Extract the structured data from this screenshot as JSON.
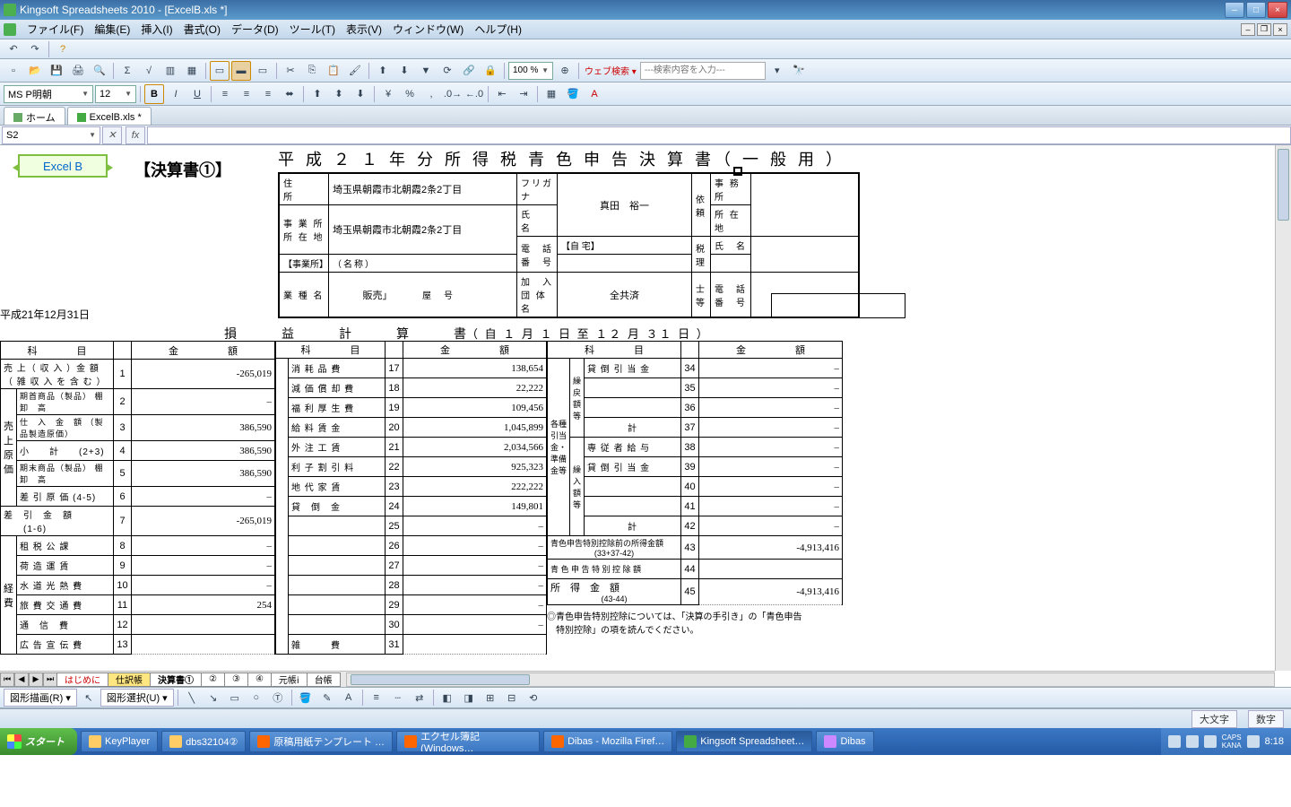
{
  "app": {
    "title": "Kingsoft Spreadsheets 2010 - [ExcelB.xls *]"
  },
  "menu": [
    "ファイル(F)",
    "編集(E)",
    "挿入(I)",
    "書式(O)",
    "データ(D)",
    "ツール(T)",
    "表示(V)",
    "ウィンドウ(W)",
    "ヘルプ(H)"
  ],
  "font": {
    "name": "MS P明朝",
    "size": "12"
  },
  "zoom": "100 %",
  "websearch": {
    "label": "ウェブ検索 ▾",
    "placeholder": "---検索内容を入力---"
  },
  "doctabs": {
    "home": "ホーム",
    "file": "ExcelB.xls *"
  },
  "namebox": "S2",
  "drawbar": {
    "shape_menu": "図形描画(R) ▾",
    "select_menu": "図形選択(U) ▾"
  },
  "status": {
    "caps": "大文字",
    "num": "数字"
  },
  "sheettabs": [
    "はじめに",
    "仕訳帳",
    "決算書①",
    "②",
    "③",
    "④",
    "元帳ⅰ",
    "台帳"
  ],
  "taskbar": {
    "start": "スタート",
    "items": [
      "KeyPlayer",
      "dbs32104②",
      "原稿用紙テンプレート …",
      "エクセル簿記(Windows…",
      "Dibas - Mozilla Firef…",
      "Kingsoft Spreadsheet…",
      "Dibas"
    ],
    "caps": "CAPS",
    "kana": "KANA",
    "clock": "8:18"
  },
  "doc": {
    "button_label": "Excel B",
    "heading_bracket": "【決算書①】",
    "heading_main": "平 成 ２ １ 年 分 所 得 税 青 色 申 告 決 算 書（ 一 般 用 ）",
    "info": {
      "address_lbl": "住　　所",
      "address": "埼玉県朝霞市北朝霞2条2丁目",
      "office_lbl1": "事 業 所",
      "office_lbl2": "所 在 地",
      "office": "埼玉県朝霞市北朝霞2条2丁目",
      "biz_lbl": "業 種 名",
      "biz": "販売」",
      "code_lbl": "屋　号",
      "furi_lbl": "フリガナ",
      "name_lbl": "氏　　名",
      "name": "真田　裕一",
      "tel_lbl1": "電　話",
      "tel_lbl2": "番　号",
      "tel_home": "【自 宅】",
      "tel_office": "【事業所】",
      "org_lbl1": "加　入",
      "org_lbl2": "団 体 名",
      "org": "全共済",
      "req_lbl": "依頼",
      "acct_lbl1": "事 務 所",
      "acct_lbl2": "所 在 地",
      "tax_lbl": "税理",
      "taxname_lbl1": "氏　名",
      "taxname_lbl2": "（名称）",
      "lawyer_lbl": "士等",
      "lawyertel_lbl1": "電　話",
      "lawyertel_lbl2": "番　号"
    },
    "date": "平成21年12月31日",
    "pl_title": "損　益　計　算　書",
    "pl_range": "（ 自 １ 月 １ 日 至 １２ 月 ３１ 日 ）",
    "hdr": {
      "subject": "科　　　　目",
      "amount": "金　　　　　額"
    },
    "col1": {
      "r1_name": "売 上（ 収 入 ）金 額",
      "r1_sub": "（ 雑 収 入 を 含 む ）",
      "r1_no": "1",
      "r1_amt": "-265,019",
      "grp1": "売上原価",
      "r2_name": "期首商品（製品）\n棚　卸　高",
      "r2_no": "2",
      "r2_amt": "–",
      "r3_name": "仕　入　金　額\n（製品製造原価）",
      "r3_no": "3",
      "r3_amt": "386,590",
      "r4_name": "小　　計　　(2+3)",
      "r4_no": "4",
      "r4_amt": "386,590",
      "r5_name": "期末商品（製品）\n棚　卸　高",
      "r5_no": "5",
      "r5_amt": "386,590",
      "r6_name": "差 引 原 価 (4-5)",
      "r6_no": "6",
      "r6_amt": "–",
      "r7_name": "差　引　金　額\n　　(1-6)",
      "r7_no": "7",
      "r7_amt": "-265,019",
      "grp2": "経費",
      "r8_name": "租 税 公 課",
      "r8_no": "8",
      "r8_amt": "–",
      "r9_name": "荷 造 運 賃",
      "r9_no": "9",
      "r9_amt": "–",
      "r10_name": "水 道 光 熱 費",
      "r10_no": "10",
      "r10_amt": "–",
      "r11_name": "旅 費 交 通 費",
      "r11_no": "11",
      "r11_amt": "254",
      "r12_name": "通　信　費",
      "r12_no": "12",
      "r12_amt": "",
      "r13_name": "広 告 宣 伝 費",
      "r13_no": "13",
      "r13_amt": ""
    },
    "col2": {
      "r17_name": "消 耗 品 費",
      "r17_no": "17",
      "r17_amt": "138,654",
      "r18_name": "減 価 償 却 費",
      "r18_no": "18",
      "r18_amt": "22,222",
      "r19_name": "福 利 厚 生 費",
      "r19_no": "19",
      "r19_amt": "109,456",
      "r20_name": "給 料 賃 金",
      "r20_no": "20",
      "r20_amt": "1,045,899",
      "r21_name": "外 注 工 賃",
      "r21_no": "21",
      "r21_amt": "2,034,566",
      "r22_name": "利 子 割 引 料",
      "r22_no": "22",
      "r22_amt": "925,323",
      "r23_name": "地 代 家 賃",
      "r23_no": "23",
      "r23_amt": "222,222",
      "r24_name": "貸　倒　金",
      "r24_no": "24",
      "r24_amt": "149,801",
      "r25_no": "25",
      "r25_amt": "–",
      "r26_no": "26",
      "r26_amt": "–",
      "r27_no": "27",
      "r27_amt": "–",
      "r28_no": "28",
      "r28_amt": "–",
      "r29_no": "29",
      "r29_amt": "–",
      "r30_no": "30",
      "r30_amt": "–",
      "r31_name": "雑　　　費",
      "r31_no": "31"
    },
    "col3": {
      "grp1": "各種引当金・準備金等",
      "grp1a": "繰戻額等",
      "grp1b": "繰入額等",
      "r34_name": "貸 倒 引 当 金",
      "r34_no": "34",
      "r34_amt": "–",
      "r35_no": "35",
      "r35_amt": "–",
      "r36_no": "36",
      "r36_amt": "–",
      "r37_name": "計",
      "r37_no": "37",
      "r37_amt": "–",
      "r38_name": "専 従 者 給 与",
      "r38_no": "38",
      "r38_amt": "–",
      "r39_name": "貸 倒 引 当 金",
      "r39_no": "39",
      "r39_amt": "–",
      "r40_no": "40",
      "r40_amt": "–",
      "r41_no": "41",
      "r41_amt": "–",
      "r42_name": "計",
      "r42_no": "42",
      "r42_amt": "–",
      "r43_name": "青色申告特別控除前の所得金額",
      "r43_sub": "(33+37-42)",
      "r43_no": "43",
      "r43_amt": "-4,913,416",
      "r44_name": "青 色 申 告 特 別 控 除 額",
      "r44_no": "44",
      "r45_name": "所　得　金　額",
      "r45_sub": "(43-44)",
      "r45_no": "45",
      "r45_amt": "-4,913,416",
      "note": "◎青色申告特別控除については、「決算の手引き」の「青色申告\n　特別控除」の項を読んでください。"
    }
  }
}
